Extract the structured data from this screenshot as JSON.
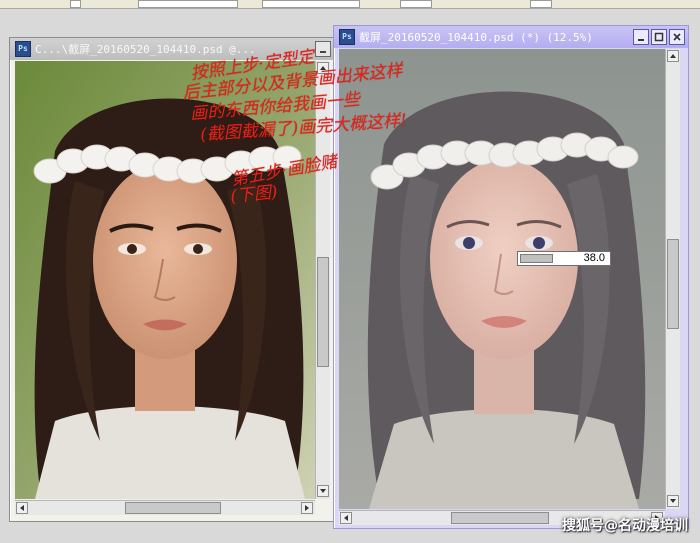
{
  "left_window": {
    "title": "C...\\截屏_20160520_104410.psd @...",
    "icon": "photoshop-document-icon"
  },
  "right_window": {
    "title": "截屏_20160520_104410.psd (*) (12.5%)",
    "icon": "photoshop-document-icon"
  },
  "opacity_readout": {
    "value": "38.0",
    "fill": 0.38
  },
  "annotation": {
    "lines": [
      "按照上步·定型定",
      "后主部分以及背景画出来这样",
      "画的东西你给我画一些",
      "(截图截漏了)画完大概这样!",
      "第五步·画脸赌",
      "(下图)"
    ],
    "color": "#e2231a"
  },
  "watermark": "搜狐号@名动漫培训",
  "colors": {
    "active_title": "#b3aef0",
    "inactive_title": "#c8c8c8"
  }
}
